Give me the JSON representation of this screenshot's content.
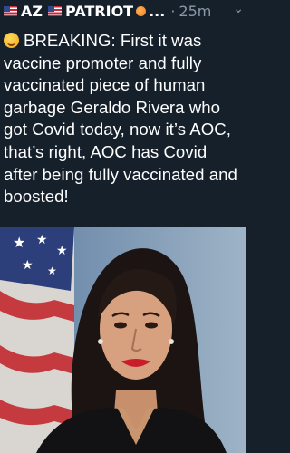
{
  "header": {
    "author_prefix": "AZ",
    "author_name": "PATRIOT",
    "ellipsis": "...",
    "separator": "·",
    "time": "25m"
  },
  "tweet": {
    "text": "BREAKING: First it was vaccine promoter and fully vaccinated piece of human garbage Geraldo Rivera who got Covid today, now it’s AOC, that’s right, AOC has Covid after being fully vaccinated and boosted!"
  },
  "icons": [
    "us-flag-icon",
    "peach-emoji-icon",
    "grinning-sweat-emoji-icon",
    "chevron-down-icon"
  ],
  "colors": {
    "background": "#15202b",
    "text": "#ffffff",
    "muted": "#8b98a5"
  }
}
